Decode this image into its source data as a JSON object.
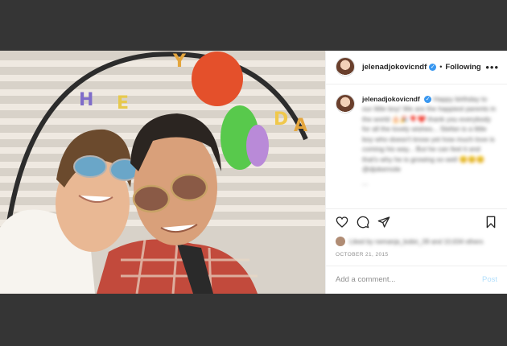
{
  "post": {
    "username": "jelenadjokovicndf",
    "follow_status": "Following",
    "more_label": "•••",
    "verified_mark": "✓",
    "caption_text": "Happy birthday to our little boy! We are the happiest parents in the world 🎂🎉🎈❤️ thank you everybody for all the lovely wishes... Stefan is a little boy who doesn't know yet how much love is coming his way... But he can feel it and that's why he is growing so well 😊😊😊 @djokernole",
    "caption_more": "...",
    "likes_text": "Liked by nemanja_bobic_09 and 10,634 others",
    "date": "OCTOBER 21, 2015",
    "comment_placeholder": "Add a comment...",
    "post_button": "Post"
  },
  "icons": {
    "like": "heart-icon",
    "comment": "comment-icon",
    "share": "share-icon",
    "save": "bookmark-icon",
    "more": "more-icon"
  }
}
